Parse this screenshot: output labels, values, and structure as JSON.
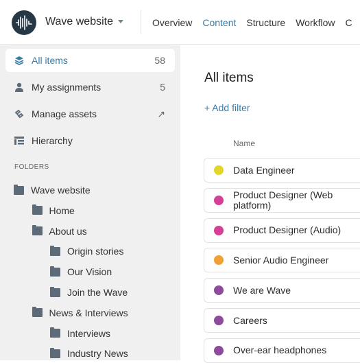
{
  "header": {
    "project": "Wave website",
    "nav": [
      {
        "label": "Overview",
        "active": false
      },
      {
        "label": "Content",
        "active": true
      },
      {
        "label": "Structure",
        "active": false
      },
      {
        "label": "Workflow",
        "active": false
      },
      {
        "label": "C",
        "active": false
      }
    ]
  },
  "sidebar": {
    "items": [
      {
        "label": "All items",
        "count": "58",
        "icon": "layers-icon",
        "active": true
      },
      {
        "label": "My assignments",
        "count": "5",
        "icon": "user-icon"
      },
      {
        "label": "Manage assets",
        "count": "↗",
        "icon": "assets-icon"
      },
      {
        "label": "Hierarchy",
        "count": "",
        "icon": "hierarchy-icon"
      }
    ],
    "folders_heading": "FOLDERS",
    "folders": [
      {
        "label": "Wave website",
        "level": 0
      },
      {
        "label": "Home",
        "level": 1
      },
      {
        "label": "About us",
        "level": 1
      },
      {
        "label": "Origin stories",
        "level": 2
      },
      {
        "label": "Our Vision",
        "level": 2
      },
      {
        "label": "Join the Wave",
        "level": 2
      },
      {
        "label": "News & Interviews",
        "level": 1
      },
      {
        "label": "Interviews",
        "level": 2
      },
      {
        "label": "Industry News",
        "level": 2
      }
    ]
  },
  "main": {
    "title": "All items",
    "add_filter": "+ Add filter",
    "column_name": "Name",
    "rows": [
      {
        "name": "Data Engineer",
        "color": "#e2d628"
      },
      {
        "name": "Product Designer (Web platform)",
        "color": "#d63f96"
      },
      {
        "name": "Product Designer (Audio)",
        "color": "#d63f96"
      },
      {
        "name": "Senior Audio Engineer",
        "color": "#f0a133"
      },
      {
        "name": "We are Wave",
        "color": "#8e4a9c"
      },
      {
        "name": "Careers",
        "color": "#8e4a9c"
      },
      {
        "name": "Over-ear headphones",
        "color": "#8e4a9c"
      }
    ]
  },
  "colors": {
    "accent": "#3a7ca5",
    "sidebar_bg": "#f0f0f0",
    "logo": "#263845"
  }
}
